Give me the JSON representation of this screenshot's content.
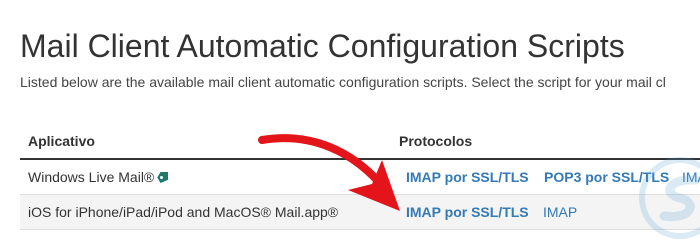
{
  "page": {
    "title": "Mail Client Automatic Configuration Scripts",
    "intro": "Listed below are the available mail client automatic configuration scripts. Select the script for your mail cl"
  },
  "table": {
    "headers": {
      "app": "Aplicativo",
      "protocols": "Protocolos"
    },
    "rows": [
      {
        "app": "Windows Live Mail®",
        "app_icon": "tag-icon",
        "protocols": [
          "IMAP por SSL/TLS",
          "POP3 por SSL/TLS",
          "IMA"
        ]
      },
      {
        "app": "iOS for iPhone/iPad/iPod and MacOS® Mail.app®",
        "protocols": [
          "IMAP por SSL/TLS",
          "IMAP"
        ]
      }
    ]
  },
  "colors": {
    "link": "#337ab7",
    "arrow": "#e3141a",
    "text": "#333333"
  }
}
